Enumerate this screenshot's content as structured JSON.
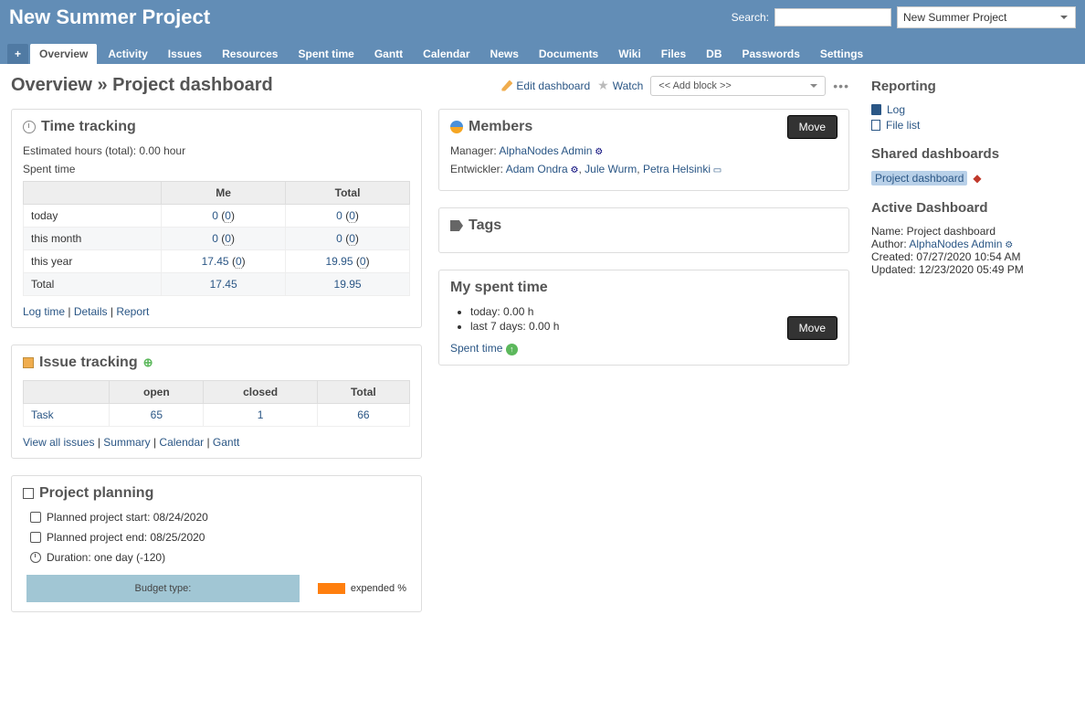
{
  "header": {
    "title": "New Summer Project",
    "search_label": "Search:",
    "project_select": "New Summer Project"
  },
  "tabs": {
    "plus": "+",
    "items": [
      "Overview",
      "Activity",
      "Issues",
      "Resources",
      "Spent time",
      "Gantt",
      "Calendar",
      "News",
      "Documents",
      "Wiki",
      "Files",
      "DB",
      "Passwords",
      "Settings"
    ]
  },
  "page": {
    "title": "Overview » Project dashboard",
    "edit_dashboard": "Edit dashboard",
    "watch": "Watch",
    "add_block": "<< Add block >>"
  },
  "time_tracking": {
    "title": "Time tracking",
    "estimated": "Estimated hours (total): 0.00 hour",
    "spent_label": "Spent time",
    "headers": [
      "",
      "Me",
      "Total"
    ],
    "rows": [
      {
        "label": "today",
        "me": "0",
        "me_p": "0",
        "total": "0",
        "total_p": "0"
      },
      {
        "label": "this month",
        "me": "0",
        "me_p": "0",
        "total": "0",
        "total_p": "0"
      },
      {
        "label": "this year",
        "me": "17.45",
        "me_p": "0",
        "total": "19.95",
        "total_p": "0"
      },
      {
        "label": "Total",
        "me": "17.45",
        "me_p": "",
        "total": "19.95",
        "total_p": ""
      }
    ],
    "links": {
      "log": "Log time",
      "details": "Details",
      "report": "Report"
    }
  },
  "issue_tracking": {
    "title": "Issue tracking",
    "headers": [
      "",
      "open",
      "closed",
      "Total"
    ],
    "rows": [
      {
        "tracker": "Task",
        "open": "65",
        "closed": "1",
        "total": "66"
      }
    ],
    "links": {
      "all": "View all issues",
      "summary": "Summary",
      "calendar": "Calendar",
      "gantt": "Gantt"
    }
  },
  "planning": {
    "title": "Project planning",
    "start": "Planned project start: 08/24/2020",
    "end": "Planned project end: 08/25/2020",
    "duration": "Duration: one day (-120)",
    "bar_label": "Budget type:",
    "legend": "expended %"
  },
  "members": {
    "title": "Members",
    "move": "Move",
    "manager_label": "Manager: ",
    "manager": "AlphaNodes Admin",
    "dev_label": "Entwickler: ",
    "devs": [
      "Adam Ondra",
      "Jule Wurm",
      "Petra Helsinki"
    ]
  },
  "tags": {
    "title": "Tags"
  },
  "my_spent": {
    "title": "My spent time",
    "move": "Move",
    "today": "today: 0.00 h",
    "week": "last 7 days: 0.00 h",
    "link": "Spent time"
  },
  "sidebar": {
    "reporting": "Reporting",
    "log": "Log",
    "file_list": "File list",
    "shared": "Shared dashboards",
    "dash_link": "Project dashboard",
    "active": "Active Dashboard",
    "name": "Name: Project dashboard",
    "author_label": "Author: ",
    "author": "AlphaNodes Admin",
    "created": "Created: 07/27/2020 10:54 AM",
    "updated": "Updated: 12/23/2020 05:49 PM"
  }
}
